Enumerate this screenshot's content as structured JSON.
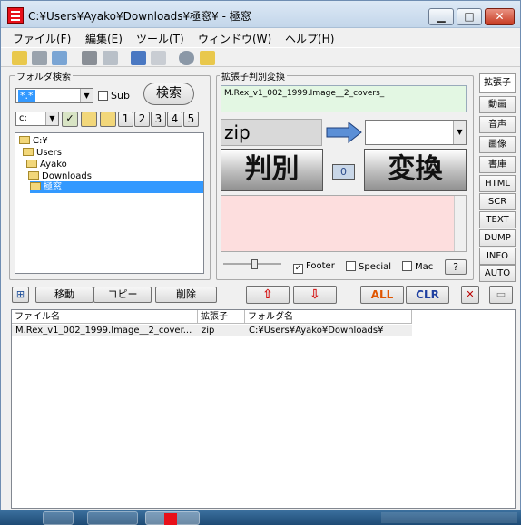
{
  "window": {
    "title": "C:¥Users¥Ayako¥Downloads¥極窓¥ - 極窓"
  },
  "menu": [
    "ファイル(F)",
    "編集(E)",
    "ツール(T)",
    "ウィンドウ(W)",
    "ヘルプ(H)"
  ],
  "folder_search": {
    "title": "フォルダ検索",
    "pattern": "*.*",
    "sub_label": "Sub",
    "search_button": "検索",
    "drive": "c:",
    "num_buttons": [
      "1",
      "2",
      "3",
      "4",
      "5"
    ],
    "tree": [
      "C:¥",
      "Users",
      "Ayako",
      "Downloads",
      "極窓"
    ]
  },
  "ext_judge": {
    "title": "拡張子判別変換",
    "filename": "M.Rex_v1_002_1999.Image__2_covers_",
    "detected_ext": "zip",
    "target_ext": "",
    "judge_button": "判別",
    "count": "0",
    "convert_button": "変換",
    "footer_label": "Footer",
    "footer_checked": true,
    "special_label": "Special",
    "mac_label": "Mac",
    "help_button": "?"
  },
  "side_tabs": [
    "拡張子",
    "動画",
    "音声",
    "画像",
    "書庫",
    "HTML",
    "SCR",
    "TEXT",
    "DUMP",
    "INFO",
    "AUTO"
  ],
  "actions": {
    "move": "移動",
    "copy": "コピー",
    "delete": "削除",
    "all": "ALL",
    "clr": "CLR"
  },
  "list": {
    "columns": [
      "ファイル名",
      "拡張子",
      "フォルダ名"
    ],
    "rows": [
      {
        "name": "M.Rex_v1_002_1999.Image__2_cover...",
        "ext": "zip",
        "folder": "C:¥Users¥Ayako¥Downloads¥"
      }
    ]
  },
  "colors": {
    "ext_box": "#e3f7e3",
    "output_box": "#fddede",
    "selection": "#3399ff"
  }
}
